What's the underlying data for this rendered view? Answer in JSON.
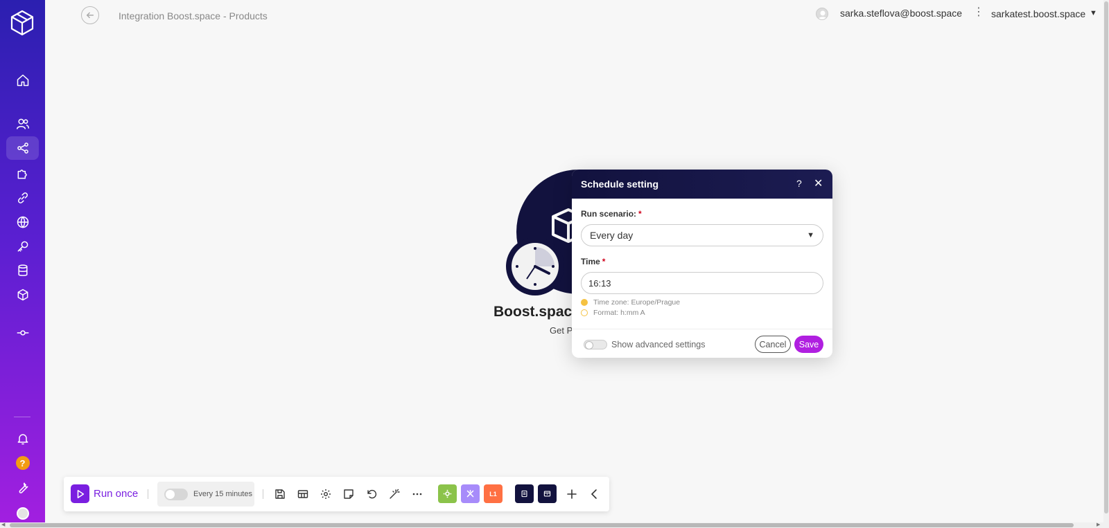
{
  "header": {
    "page_title": "Integration Boost.space - Products",
    "user_email": "sarka.steflova@boost.space",
    "org_name": "sarkatest.boost.space"
  },
  "sidebar": {
    "items": [
      {
        "name": "home",
        "icon": "home-icon"
      },
      {
        "name": "users",
        "icon": "users-icon"
      },
      {
        "name": "scenarios",
        "icon": "share-icon",
        "active": true
      },
      {
        "name": "apps",
        "icon": "puzzle-icon"
      },
      {
        "name": "connections",
        "icon": "link-icon"
      },
      {
        "name": "webhooks",
        "icon": "globe-icon"
      },
      {
        "name": "keys",
        "icon": "key-icon"
      },
      {
        "name": "data-stores",
        "icon": "database-icon"
      },
      {
        "name": "data-structures",
        "icon": "cube-icon"
      },
      {
        "name": "devices",
        "icon": "commit-icon"
      },
      {
        "name": "notifications",
        "icon": "bell-icon"
      },
      {
        "name": "help",
        "icon": "help-icon",
        "label": "?"
      },
      {
        "name": "tools",
        "icon": "wrench-icon"
      },
      {
        "name": "profile",
        "icon": "avatar-icon"
      }
    ]
  },
  "module": {
    "name": "Boost.space",
    "subtitle": "Get P"
  },
  "dialog": {
    "title": "Schedule setting",
    "help_label": "?",
    "close_label": "✕",
    "run_scenario_label": "Run scenario:",
    "run_scenario_value": "Every day",
    "time_label": "Time",
    "time_value": "16:13",
    "timezone_hint": "Time zone: Europe/Prague",
    "format_hint": "Format: h:mm A",
    "advanced_label": "Show advanced settings",
    "cancel_label": "Cancel",
    "save_label": "Save",
    "required_marker": "*"
  },
  "toolbar": {
    "run_label": "Run once",
    "schedule_label": "Every 15 minutes",
    "square_buttons": [
      {
        "label": "",
        "color": "#8bc34a"
      },
      {
        "label": "",
        "color": "#a78bfa"
      },
      {
        "label": "L1",
        "color": "#ff7043"
      },
      {
        "label": "",
        "color": "#12123e"
      },
      {
        "label": "",
        "color": "#12123e"
      }
    ]
  },
  "colors": {
    "accent": "#7a1fe0",
    "save": "#b01fe0",
    "dialog_header": "#12123e",
    "required": "#d0021b"
  }
}
